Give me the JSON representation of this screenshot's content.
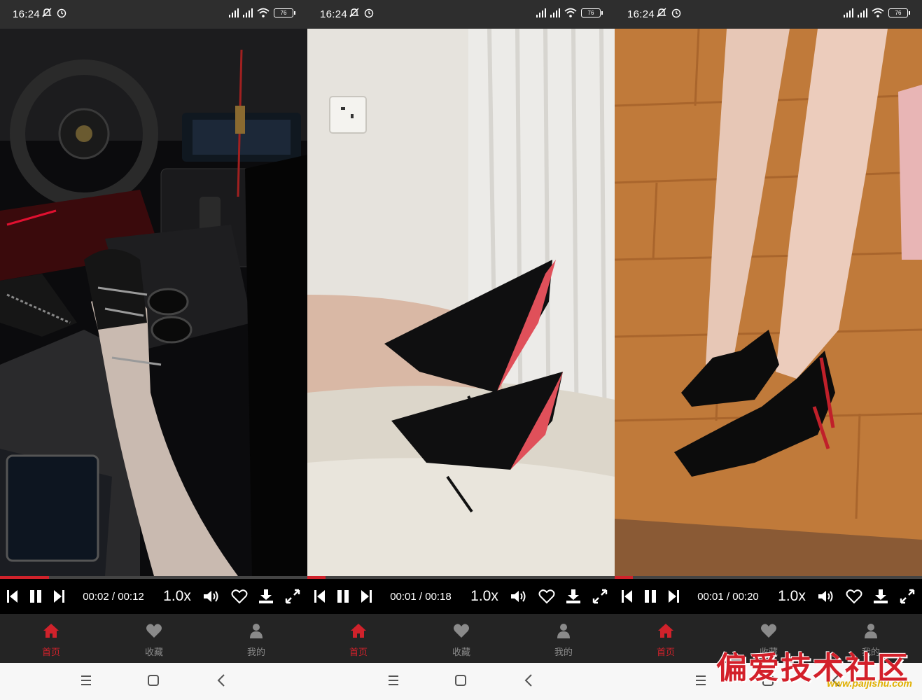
{
  "phones": [
    {
      "status": {
        "time": "16:24",
        "battery": "76"
      },
      "player": {
        "time": "00:02 / 00:12",
        "speed": "1.0x",
        "progress": 0.16
      },
      "tabs": [
        {
          "label": "首页"
        },
        {
          "label": "收藏"
        },
        {
          "label": "我的"
        }
      ]
    },
    {
      "status": {
        "time": "16:24",
        "battery": "76"
      },
      "player": {
        "time": "00:01 / 00:18",
        "speed": "1.0x",
        "progress": 0.06
      },
      "tabs": [
        {
          "label": "首页"
        },
        {
          "label": "收藏"
        },
        {
          "label": "我的"
        }
      ]
    },
    {
      "status": {
        "time": "16:24",
        "battery": "76"
      },
      "player": {
        "time": "00:01 / 00:20",
        "speed": "1.0x",
        "progress": 0.06
      },
      "tabs": [
        {
          "label": "首页"
        },
        {
          "label": "收藏"
        },
        {
          "label": "我的"
        }
      ]
    }
  ],
  "colors": {
    "accent": "#d0222b",
    "tab_inactive": "#8a8a8a",
    "controls_bg": "#000000"
  },
  "icons": {
    "controls": [
      "previous-icon",
      "pause-icon",
      "next-icon",
      "volume-icon",
      "heart-icon",
      "download-icon",
      "fullscreen-icon"
    ],
    "tabs": [
      "home-icon",
      "heart-icon",
      "user-icon"
    ],
    "nav": [
      "menu-icon",
      "home-square-icon",
      "back-icon"
    ]
  },
  "watermark": {
    "title": "偏爱技术社区",
    "url": "www.paijishu.com"
  }
}
